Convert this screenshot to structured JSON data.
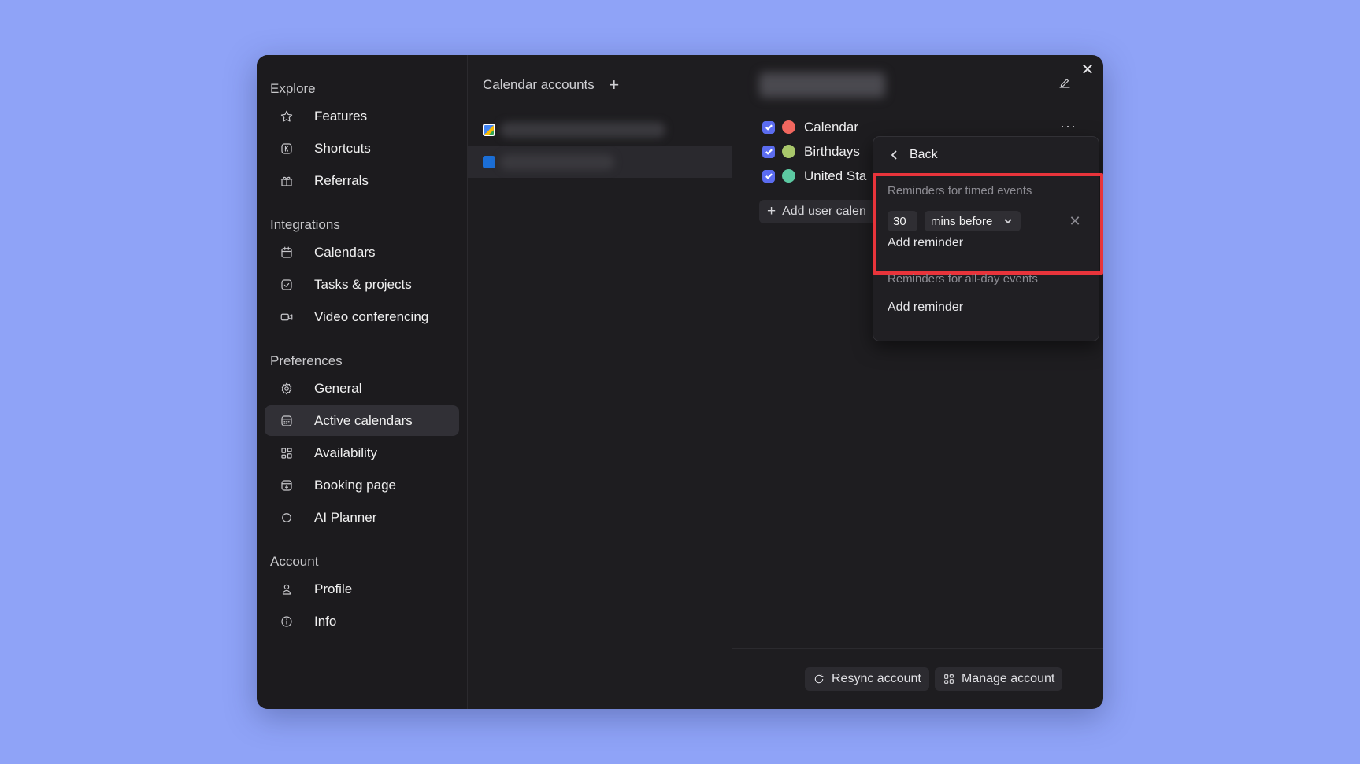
{
  "sidebar": {
    "sections": [
      {
        "title": "Explore",
        "items": [
          {
            "label": "Features",
            "icon": "star-icon"
          },
          {
            "label": "Shortcuts",
            "icon": "keyboard-k-icon"
          },
          {
            "label": "Referrals",
            "icon": "gift-icon"
          }
        ]
      },
      {
        "title": "Integrations",
        "items": [
          {
            "label": "Calendars",
            "icon": "calendar-icon"
          },
          {
            "label": "Tasks & projects",
            "icon": "checkbox-icon"
          },
          {
            "label": "Video conferencing",
            "icon": "video-camera-icon"
          }
        ]
      },
      {
        "title": "Preferences",
        "items": [
          {
            "label": "General",
            "icon": "gear-icon"
          },
          {
            "label": "Active calendars",
            "icon": "calendar-grid-icon",
            "active": true
          },
          {
            "label": "Availability",
            "icon": "grid-icon"
          },
          {
            "label": "Booking page",
            "icon": "booking-icon"
          },
          {
            "label": "AI Planner",
            "icon": "circle-icon"
          }
        ]
      },
      {
        "title": "Account",
        "items": [
          {
            "label": "Profile",
            "icon": "user-icon"
          },
          {
            "label": "Info",
            "icon": "info-icon"
          }
        ]
      }
    ]
  },
  "accounts": {
    "header": "Calendar accounts",
    "add_symbol": "+"
  },
  "calendars": {
    "items": [
      {
        "label": "Calendar",
        "color": "#f2675f"
      },
      {
        "label": "Birthdays",
        "color": "#a9c76b"
      },
      {
        "label": "United Sta",
        "color": "#5cc9a2"
      }
    ],
    "add_button": "Add user calen",
    "more": "···"
  },
  "popover": {
    "back": "Back",
    "timed_label": "Reminders for timed events",
    "timed_value": "30",
    "timed_unit": "mins before",
    "timed_add": "Add reminder",
    "allday_label": "Reminders for all-day events",
    "allday_add": "Add reminder"
  },
  "footer": {
    "resync": "Resync account",
    "manage": "Manage account"
  },
  "colors": {
    "accent": "#5b6cf0",
    "highlight": "#e8343b",
    "background": "#8fa3f7"
  }
}
